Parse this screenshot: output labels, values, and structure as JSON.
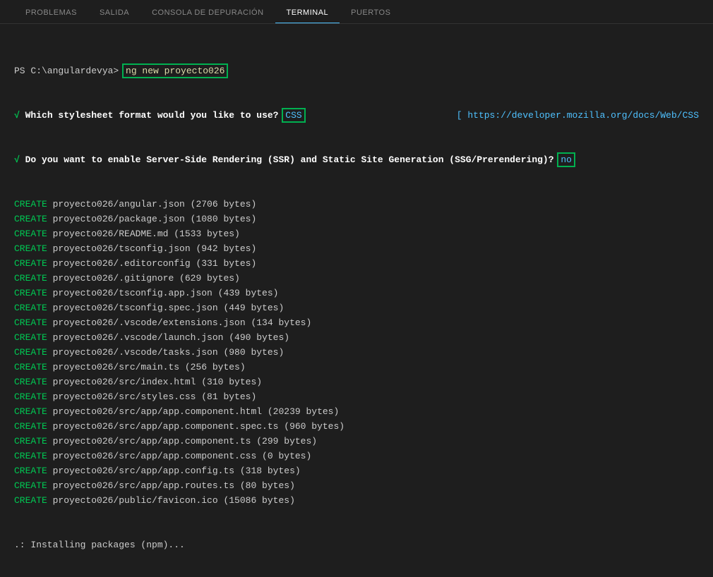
{
  "tabs": {
    "problems": "PROBLEMAS",
    "output": "SALIDA",
    "debug": "CONSOLA DE DEPURACIÓN",
    "terminal": "TERMINAL",
    "ports": "PUERTOS"
  },
  "prompt": "PS C:\\angulardevya> ",
  "command": "ng new proyecto026",
  "q1": {
    "check": "√",
    "text": " Which stylesheet format would you like to use? ",
    "answer": "CSS",
    "link": "[ https://developer.mozilla.org/docs/Web/CSS"
  },
  "q2": {
    "check": "√",
    "text": " Do you want to enable Server-Side Rendering (SSR) and Static Site Generation (SSG/Prerendering)? ",
    "answer": "no"
  },
  "createLabel": "CREATE",
  "files": [
    "proyecto026/angular.json (2706 bytes)",
    "proyecto026/package.json (1080 bytes)",
    "proyecto026/README.md (1533 bytes)",
    "proyecto026/tsconfig.json (942 bytes)",
    "proyecto026/.editorconfig (331 bytes)",
    "proyecto026/.gitignore (629 bytes)",
    "proyecto026/tsconfig.app.json (439 bytes)",
    "proyecto026/tsconfig.spec.json (449 bytes)",
    "proyecto026/.vscode/extensions.json (134 bytes)",
    "proyecto026/.vscode/launch.json (490 bytes)",
    "proyecto026/.vscode/tasks.json (980 bytes)",
    "proyecto026/src/main.ts (256 bytes)",
    "proyecto026/src/index.html (310 bytes)",
    "proyecto026/src/styles.css (81 bytes)",
    "proyecto026/src/app/app.component.html (20239 bytes)",
    "proyecto026/src/app/app.component.spec.ts (960 bytes)",
    "proyecto026/src/app/app.component.ts (299 bytes)",
    "proyecto026/src/app/app.component.css (0 bytes)",
    "proyecto026/src/app/app.config.ts (318 bytes)",
    "proyecto026/src/app/app.routes.ts (80 bytes)",
    "proyecto026/public/favicon.ico (15086 bytes)"
  ],
  "installing": ".: Installing packages (npm)..."
}
